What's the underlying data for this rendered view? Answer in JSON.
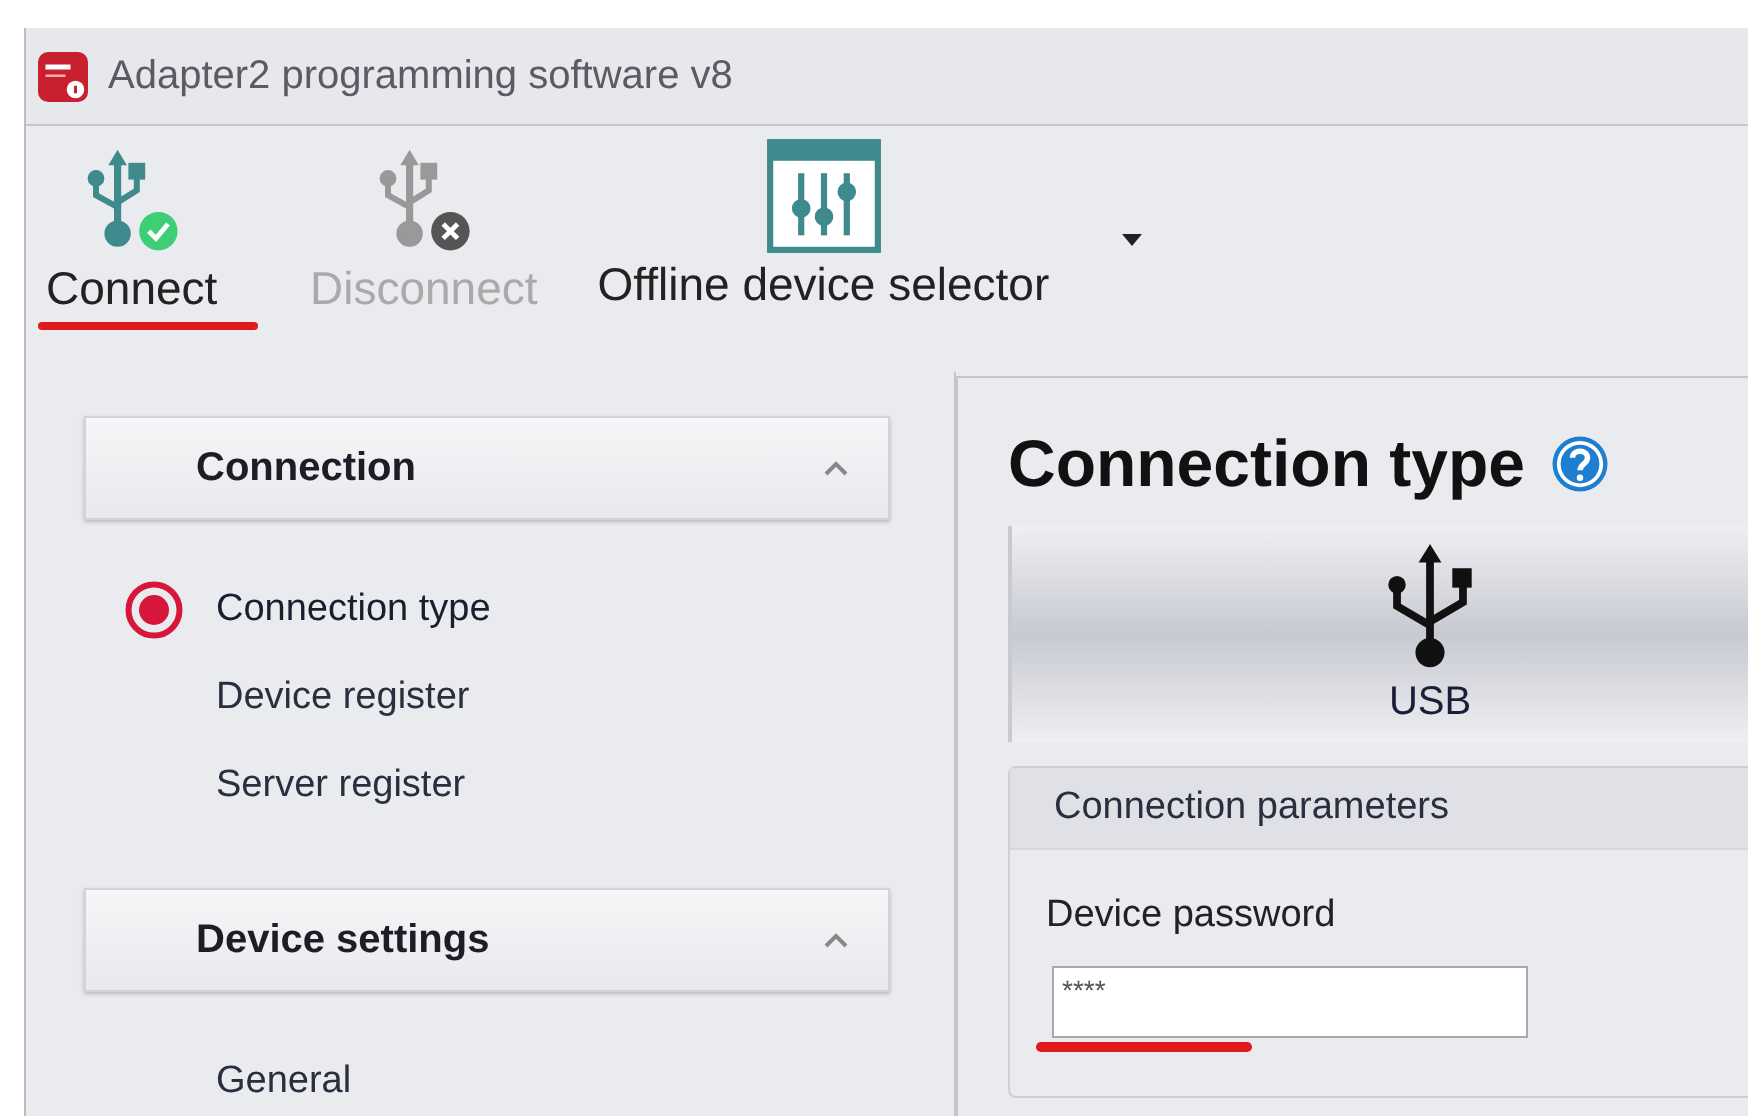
{
  "window": {
    "title": "Adapter2 programming software v8"
  },
  "toolbar": [
    {
      "kind": "connect",
      "label": "Connect",
      "disabled": false,
      "highlighted": true
    },
    {
      "kind": "disconnect",
      "label": "Disconnect",
      "disabled": true,
      "highlighted": false
    },
    {
      "kind": "selector",
      "label": "Offline device selector",
      "disabled": false,
      "highlighted": false
    }
  ],
  "sidebar": {
    "sections": [
      {
        "title": "Connection",
        "expanded": true,
        "items": [
          {
            "label": "Connection type",
            "selected": true
          },
          {
            "label": "Device register",
            "selected": false
          },
          {
            "label": "Server register",
            "selected": false
          }
        ]
      },
      {
        "title": "Device settings",
        "expanded": true,
        "items": [
          {
            "label": "General",
            "selected": false
          }
        ]
      }
    ]
  },
  "content": {
    "title": "Connection type",
    "connection_option": {
      "label": "USB"
    },
    "group": {
      "title": "Connection parameters",
      "field_label": "Device password",
      "field_value": "****",
      "highlighted": true
    }
  }
}
